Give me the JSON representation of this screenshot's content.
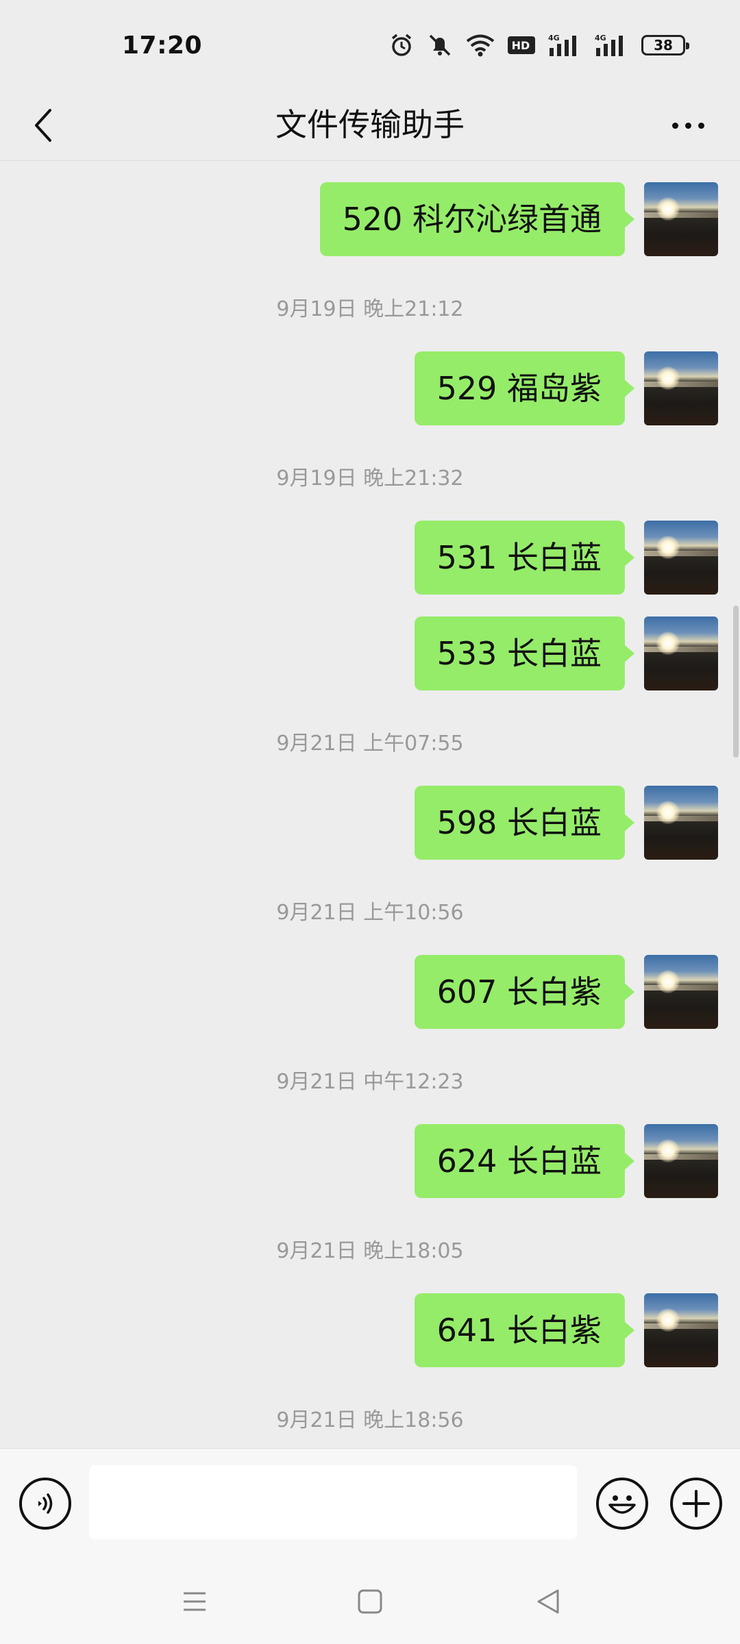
{
  "status_bar": {
    "time": "17:20",
    "icons": [
      "alarm-icon",
      "mute-icon",
      "wifi-icon",
      "hd-icon",
      "signal-4g-icon",
      "signal-4g-icon"
    ],
    "hd_label": "HD",
    "net1": "4G",
    "net2": "4G",
    "battery": "38"
  },
  "header": {
    "title": "文件传输助手",
    "back_icon": "chevron-left-icon",
    "more_icon": "more-icon"
  },
  "messages": [
    {
      "text": "520 科尔沁绿首通"
    },
    {
      "timestamp": "9月19日 晚上21:12"
    },
    {
      "text": "529 福岛紫"
    },
    {
      "timestamp": "9月19日 晚上21:32"
    },
    {
      "text": "531 长白蓝"
    },
    {
      "text": "533 长白蓝"
    },
    {
      "timestamp": "9月21日 上午07:55"
    },
    {
      "text": "598 长白蓝"
    },
    {
      "timestamp": "9月21日 上午10:56"
    },
    {
      "text": "607 长白紫"
    },
    {
      "timestamp": "9月21日 中午12:23"
    },
    {
      "text": "624 长白蓝"
    },
    {
      "timestamp": "9月21日 晚上18:05"
    },
    {
      "text": "641 长白紫"
    },
    {
      "timestamp": "9月21日 晚上18:56"
    }
  ],
  "input_bar": {
    "voice_icon": "voice-icon",
    "input_value": "",
    "emoji_icon": "emoji-icon",
    "plus_icon": "plus-icon"
  },
  "nav_bar": {
    "icons": [
      "menu-icon",
      "home-icon",
      "back-icon"
    ]
  },
  "colors": {
    "background": "#ededed",
    "bubble": "#95ec69",
    "timestamp": "#999999"
  }
}
